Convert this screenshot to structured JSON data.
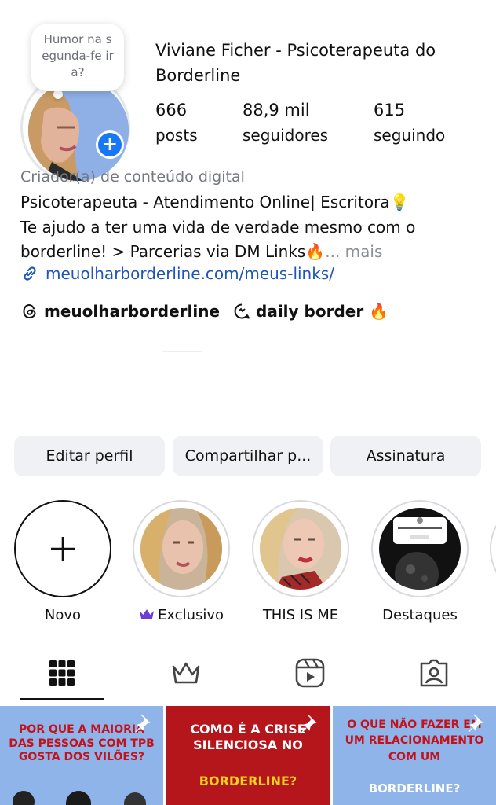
{
  "profile": {
    "note": "Humor na segunda-fe ira?",
    "name": "Viviane Ficher - Psicoterapeuta do Borderline",
    "stats": [
      {
        "num": "666",
        "label": "posts"
      },
      {
        "num": "88,9 mil",
        "label": "seguidores"
      },
      {
        "num": "615",
        "label": "seguindo"
      }
    ],
    "category": "Criador(a) de conteúdo digital",
    "bio_lines": [
      "Psicoterapeuta - Atendimento Online| Escritora💡",
      "Te ajudo a ter uma vida de verdade mesmo com o",
      "borderline! > Parcerias via DM Links🔥"
    ],
    "more": "... mais",
    "link": "meuolharborderline.com/meus-links/",
    "threads_handle": "meuolharborderline",
    "channel": "daily border 🔥"
  },
  "buttons": {
    "edit": "Editar perfil",
    "share": "Compartilhar p...",
    "subscription": "Assinatura"
  },
  "highlights": [
    {
      "label": "Novo"
    },
    {
      "label": "Exclusivo"
    },
    {
      "label": "THIS IS ME"
    },
    {
      "label": "Destaques"
    }
  ],
  "posts": [
    {
      "text": "POR QUE A MAIORIA DAS PESSOAS COM TPB GOSTA DOS VILÕES?"
    },
    {
      "text_top": "COMO É A CRISE SILENCIOSA NO",
      "text_bottom": "BORDERLINE?"
    },
    {
      "text_top": "O QUE NÃO FAZER EM UM RELACIONAMENTO COM UM",
      "text_bottom": "BORDERLINE?"
    }
  ],
  "colors": {
    "link": "#1d56b8",
    "badge": "#1877f2",
    "tile1_bg": "#8fb4ea",
    "tile2_bg": "#b5161c",
    "tile3_bg": "#8fb4ea",
    "tile_text_red": "#c4121b",
    "tile_text_yellow": "#f2d21b"
  }
}
